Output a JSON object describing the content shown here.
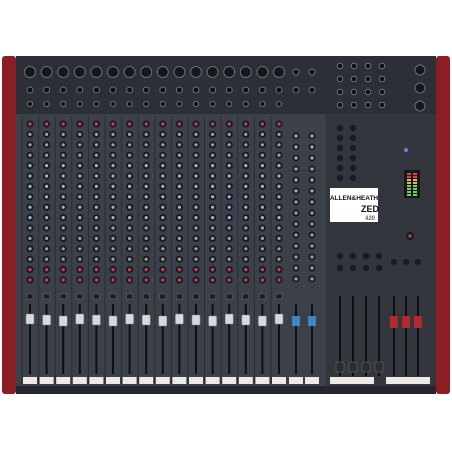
{
  "image": {
    "subject": "audio mixing console",
    "brand": "ALLEN&HEATH",
    "model": "ZED",
    "model_number": "420"
  },
  "mixer": {
    "mono_channels": 16,
    "stereo_channels": 2,
    "knob_rows": 16,
    "group_faders": 4,
    "master_faders": 3
  },
  "colors": {
    "panel": "#3c4048",
    "panel_dark": "#24272d",
    "side_cheek": "#8a1e22",
    "fader_cap": "#d8d8d8",
    "fader_cap_blue": "#3f86c8",
    "fader_cap_red": "#b52a2e",
    "knob": "#1a1c20",
    "knob_cap_blue": "#8fb6d9",
    "knob_cap_red": "#c6484c",
    "led_green": "#6fd35a",
    "led_yellow": "#e0c23a",
    "scribble_strip": "#eceae2"
  }
}
